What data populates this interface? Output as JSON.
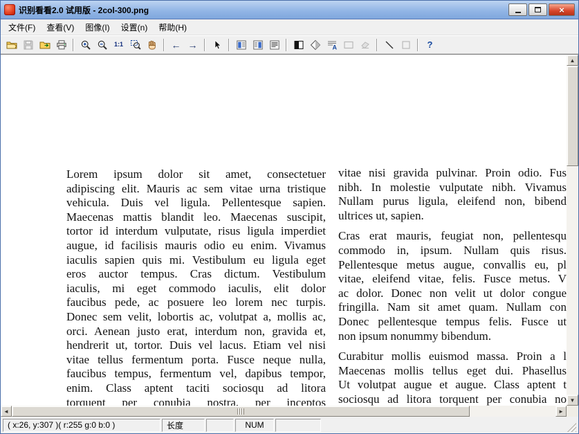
{
  "window": {
    "title": "识别看看2.0 试用版 - 2col-300.png",
    "controls": {
      "close_glyph": "×"
    }
  },
  "menu_bar": {
    "items": [
      {
        "name": "file",
        "label": "文件(F)"
      },
      {
        "name": "view",
        "label": "查看(V)"
      },
      {
        "name": "image",
        "label": "图像(I)"
      },
      {
        "name": "settings",
        "label": "设置(n)"
      },
      {
        "name": "help",
        "label": "帮助(H)"
      }
    ]
  },
  "toolbar": {
    "glyphs": {
      "arrow-left": "←",
      "arrow-right": "→",
      "one-to-one": "1:1",
      "help": "?"
    },
    "groups": [
      {
        "buttons": [
          {
            "name": "open",
            "icon": "folder-open",
            "enabled": true
          },
          {
            "name": "save",
            "icon": "save",
            "enabled": false
          },
          {
            "name": "browse",
            "icon": "folder-scan",
            "enabled": true
          },
          {
            "name": "print",
            "icon": "printer",
            "enabled": true
          }
        ]
      },
      {
        "buttons": [
          {
            "name": "zoom-in",
            "icon": "zoom-in",
            "enabled": true
          },
          {
            "name": "zoom-out",
            "icon": "zoom-out",
            "enabled": true
          },
          {
            "name": "actual-size",
            "icon": "one-to-one",
            "enabled": true
          },
          {
            "name": "zoom-area",
            "icon": "zoom-rect",
            "enabled": true
          },
          {
            "name": "pan",
            "icon": "hand",
            "enabled": true
          }
        ]
      },
      {
        "buttons": [
          {
            "name": "prev-page",
            "icon": "arrow-left",
            "enabled": true
          },
          {
            "name": "next-page",
            "icon": "arrow-right",
            "enabled": true
          }
        ]
      },
      {
        "buttons": [
          {
            "name": "select-region",
            "icon": "select",
            "enabled": true
          }
        ]
      },
      {
        "buttons": [
          {
            "name": "layout-left",
            "icon": "layout-left",
            "enabled": true
          },
          {
            "name": "layout-right",
            "icon": "layout-right",
            "enabled": true
          },
          {
            "name": "layout-lines",
            "icon": "layout-lines",
            "enabled": true
          }
        ]
      },
      {
        "buttons": [
          {
            "name": "invert",
            "icon": "invert",
            "enabled": true
          },
          {
            "name": "dither",
            "icon": "dither",
            "enabled": true
          },
          {
            "name": "ocr-text",
            "icon": "ocr-text",
            "enabled": true
          },
          {
            "name": "draw-rect",
            "icon": "rect",
            "enabled": false
          },
          {
            "name": "eraser",
            "icon": "eraser",
            "enabled": false
          }
        ]
      },
      {
        "buttons": [
          {
            "name": "draw-line",
            "icon": "line",
            "enabled": true
          },
          {
            "name": "draw-square",
            "icon": "square",
            "enabled": false
          }
        ]
      },
      {
        "buttons": [
          {
            "name": "help",
            "icon": "help",
            "enabled": true
          }
        ]
      }
    ]
  },
  "document": {
    "left_column": {
      "paragraphs": [
        {
          "continues": true,
          "lines": [
            "Lorem ipsum dolor sit amet, consectetuer",
            "adipiscing elit. Mauris ac sem vitae urna tristique",
            "vehicula. Duis vel ligula. Pellentesque sapien.",
            "Maecenas mattis blandit leo. Maecenas suscipit,",
            "tortor id interdum vulputate, risus ligula imperdiet",
            "augue, id facilisis mauris odio eu enim. Vivamus",
            "iaculis sapien quis mi. Vestibulum eu ligula eget",
            "eros auctor tempus. Cras dictum. Vestibulum",
            "iaculis, mi eget commodo iaculis, elit dolor",
            "faucibus pede, ac posuere leo lorem nec turpis.",
            "Donec sem velit, lobortis ac, volutpat a, mollis ac,",
            "orci. Aenean justo erat, interdum non, gravida et,",
            "hendrerit ut, tortor. Duis vel lacus. Etiam vel nisi",
            "vitae tellus fermentum porta. Fusce neque nulla,",
            "faucibus tempus, fermentum vel, dapibus tempor,",
            "enim. Class aptent taciti sociosqu ad litora",
            "torquent per conubia nostra, per inceptos"
          ]
        }
      ]
    },
    "right_column": {
      "paragraphs": [
        {
          "continues": false,
          "lines": [
            "vitae nisi gravida pulvinar. Proin odio. Fus",
            "nibh. In molestie vulputate nibh. Vivamus",
            "Nullam purus ligula, eleifend non, bibend",
            "ultrices ut, sapien."
          ]
        },
        {
          "continues": false,
          "lines": [
            "Cras erat mauris, feugiat non, pellentesqu",
            "commodo in, ipsum. Nullam quis risus.",
            "Pellentesque metus augue, convallis eu, pl",
            "vitae, eleifend vitae, felis. Fusce metus. V",
            "ac dolor. Donec non velit ut dolor congue",
            "fringilla. Nam sit amet quam. Nullam con",
            "Donec pellentesque tempus felis. Fusce ut",
            "non ipsum nonummy bibendum."
          ]
        },
        {
          "continues": true,
          "lines": [
            "Curabitur mollis euismod massa. Proin a l",
            "Maecenas mollis tellus eget dui. Phasellus",
            "Ut volutpat augue et augue. Class aptent t",
            "sociosqu ad litora torquent per conubia no"
          ]
        }
      ]
    }
  },
  "scrollbars": {
    "up_glyph": "▲",
    "down_glyph": "▼",
    "left_glyph": "◄",
    "right_glyph": "►"
  },
  "status_bar": {
    "panes": [
      {
        "name": "pixel-info",
        "text": "( x:26, y:307 )( r:255 g:0 b:0 )"
      },
      {
        "name": "length",
        "text": "长度"
      },
      {
        "name": "pane-3",
        "text": ""
      },
      {
        "name": "num-lock",
        "text": "NUM"
      },
      {
        "name": "pane-5",
        "text": ""
      }
    ]
  }
}
